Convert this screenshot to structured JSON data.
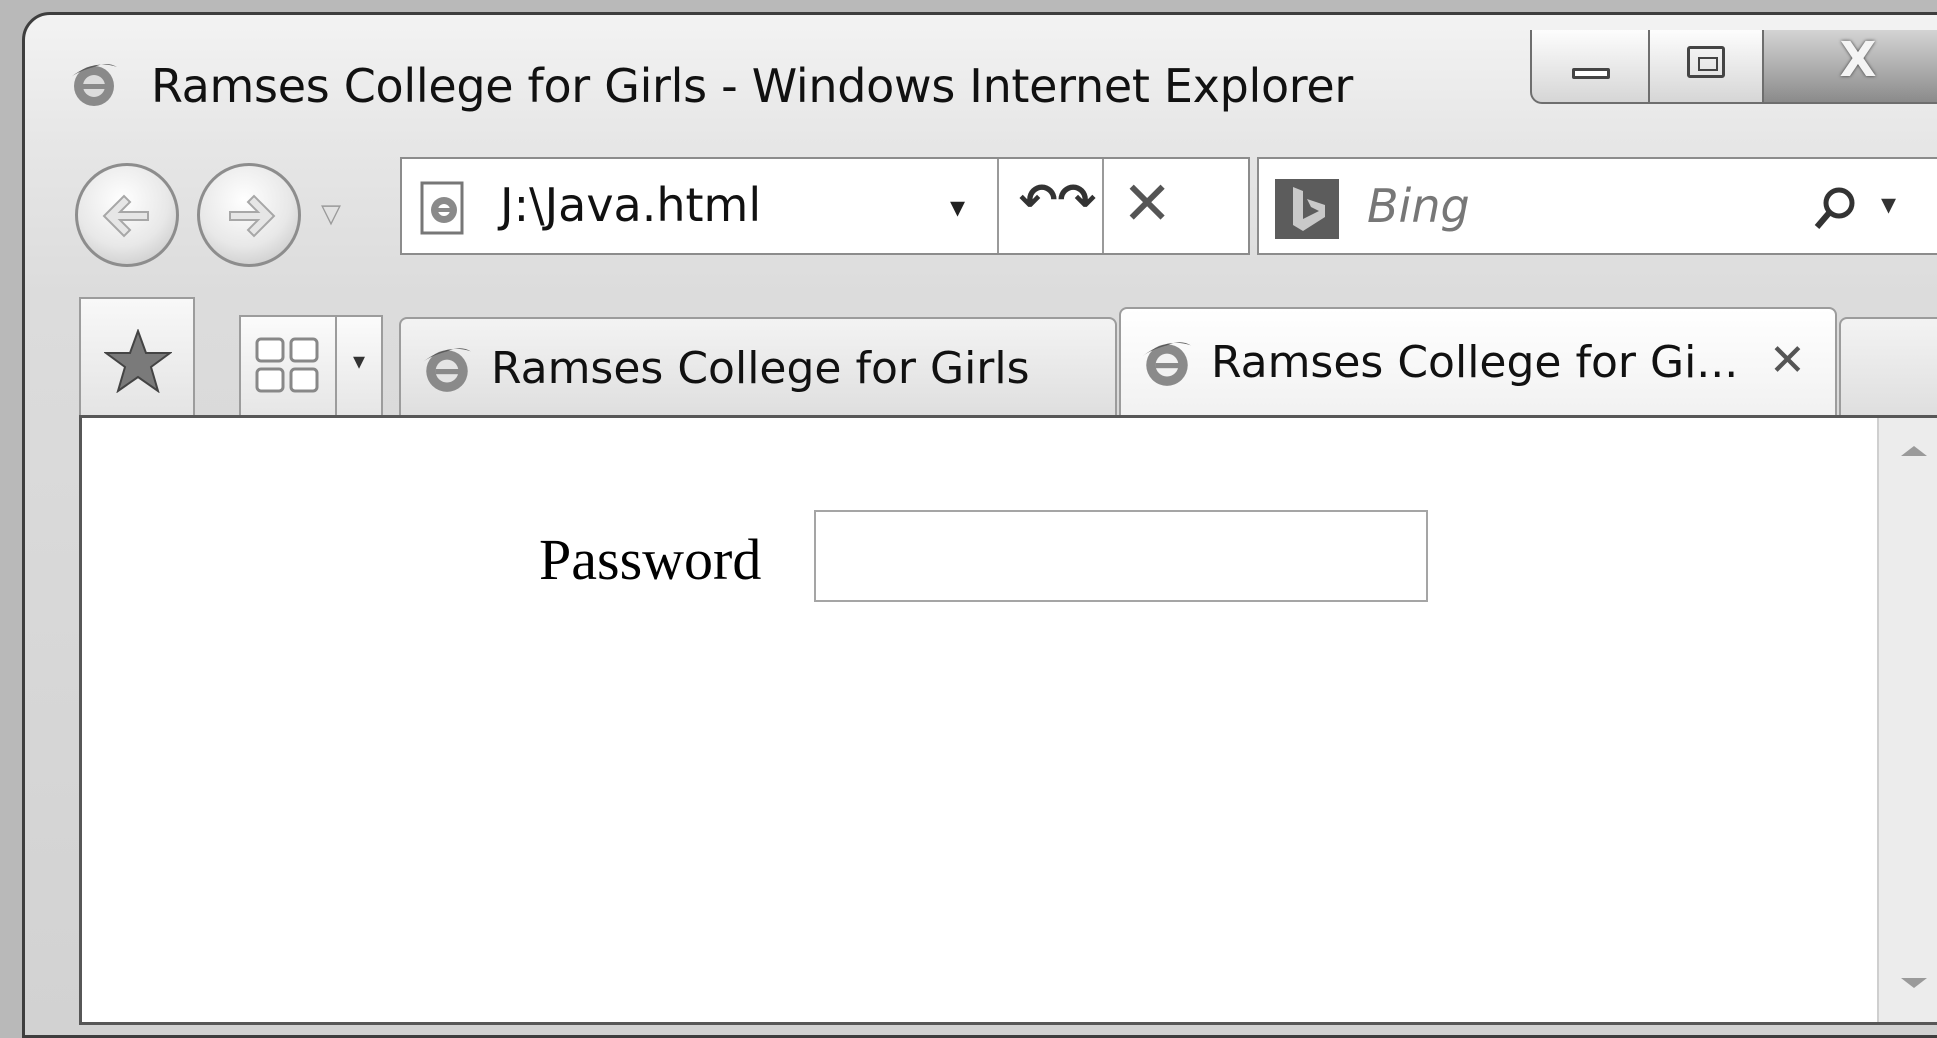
{
  "window": {
    "title": "Ramses College for Girls - Windows Internet Explorer",
    "icon": "ie-logo-icon",
    "controls": {
      "minimize_icon": "minimize-icon",
      "maximize_icon": "restore-icon",
      "close_icon": "close-icon",
      "close_label": "X"
    }
  },
  "navigation": {
    "back_icon": "back-arrow-icon",
    "forward_icon": "forward-arrow-icon",
    "history_dropdown_glyph": "▽"
  },
  "address_bar": {
    "value": "J:\\Java.html",
    "page_icon": "ie-page-icon",
    "dropdown_glyph": "▾",
    "refresh_glyph": "↶↷",
    "stop_glyph": "✕"
  },
  "search_box": {
    "placeholder": "Bing",
    "provider_icon": "bing-logo-icon",
    "search_icon": "magnifier-icon",
    "dropdown_glyph": "▾"
  },
  "tab_bar": {
    "favorites_icon": "star-icon",
    "quick_tabs_icon": "quick-tabs-icon",
    "quick_tabs_dropdown_glyph": "▾",
    "tabs": [
      {
        "label": "Ramses College for Girls",
        "active": false
      },
      {
        "label": "Ramses College for Gi...",
        "active": true,
        "close_glyph": "✕"
      }
    ]
  },
  "page": {
    "password_label": "Password",
    "password_value": ""
  },
  "colors": {
    "window_border": "#3e3e3e",
    "chrome_background": "#e0e0e0",
    "content_background": "#ffffff"
  }
}
